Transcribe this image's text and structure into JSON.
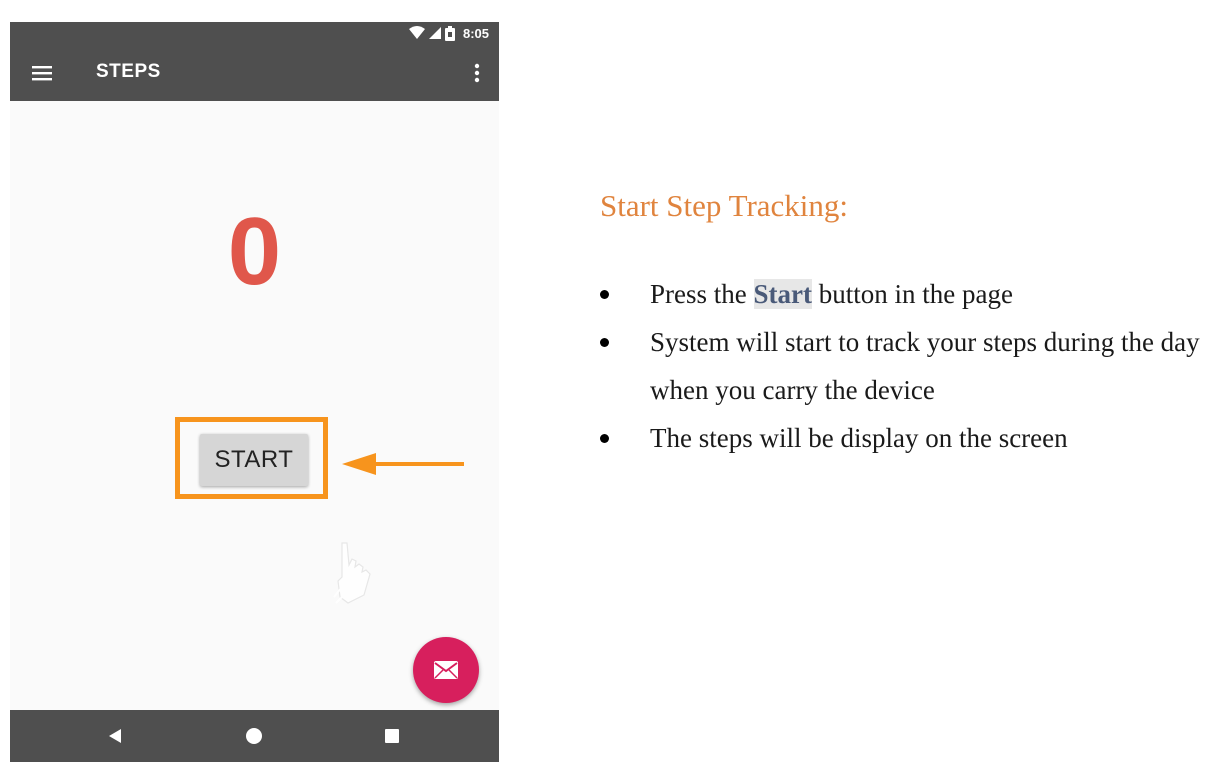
{
  "status_bar": {
    "time": "8:05",
    "icons": [
      "wifi-icon",
      "signal-icon",
      "battery-icon"
    ]
  },
  "app_bar": {
    "title": "STEPS",
    "left_icon": "menu-icon",
    "right_icon": "overflow-menu-icon"
  },
  "main": {
    "step_count": "0",
    "start_button_label": "START"
  },
  "fab": {
    "icon": "mail-icon"
  },
  "nav_bar": {
    "icons": [
      "back-icon",
      "home-icon",
      "recents-icon"
    ]
  },
  "instructions": {
    "title": "Start Step Tracking:",
    "items": [
      {
        "before": "Press the ",
        "highlight": "Start",
        "after": " button in the page"
      },
      {
        "text": "System will start to track your steps during the day when you carry the device"
      },
      {
        "text": "The steps will be display on the screen"
      }
    ]
  },
  "colors": {
    "app_bar": "#4f4f4f",
    "step_count": "#e0574b",
    "highlight_box": "#f7941d",
    "fab": "#d71f5d",
    "title": "#e0843e",
    "highlight_word": "#4a5a79"
  }
}
